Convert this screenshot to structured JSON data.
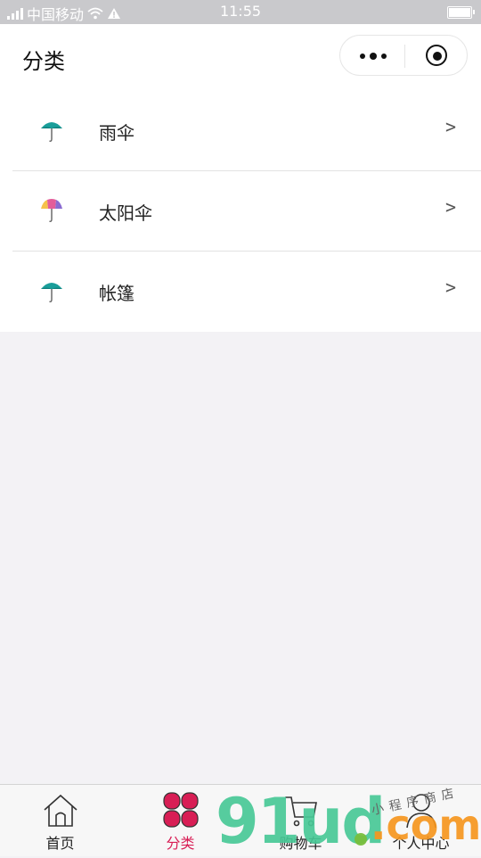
{
  "status_bar": {
    "carrier": "中国移动",
    "time": "11:55",
    "icons": [
      "signal-icon",
      "wifi-icon",
      "warning-icon",
      "battery-icon"
    ]
  },
  "nav": {
    "title": "分类",
    "capsule": {
      "more_icon": "more-dots-icon",
      "close_icon": "target-close-icon"
    }
  },
  "categories": [
    {
      "label": "雨伞",
      "icon": "umbrella-teal-icon",
      "arrow": ">"
    },
    {
      "label": "太阳伞",
      "icon": "umbrella-rainbow-icon",
      "arrow": ">"
    },
    {
      "label": "帐篷",
      "icon": "umbrella-teal-icon",
      "arrow": ">"
    }
  ],
  "tabbar": {
    "tabs": [
      {
        "label": "首页",
        "icon": "home-icon",
        "active": false
      },
      {
        "label": "分类",
        "icon": "category-icon",
        "active": true
      },
      {
        "label": "购物车",
        "icon": "cart-icon",
        "active": false
      },
      {
        "label": "个人中心",
        "icon": "user-icon",
        "active": false
      }
    ]
  },
  "watermark": {
    "text": "91ud",
    "suffix": ".com",
    "script": "小程序商店"
  },
  "colors": {
    "accent": "#d81e55",
    "teal": "#1a9e9a",
    "background": "#f3f2f5",
    "statusbar": "#c9c9cc"
  }
}
